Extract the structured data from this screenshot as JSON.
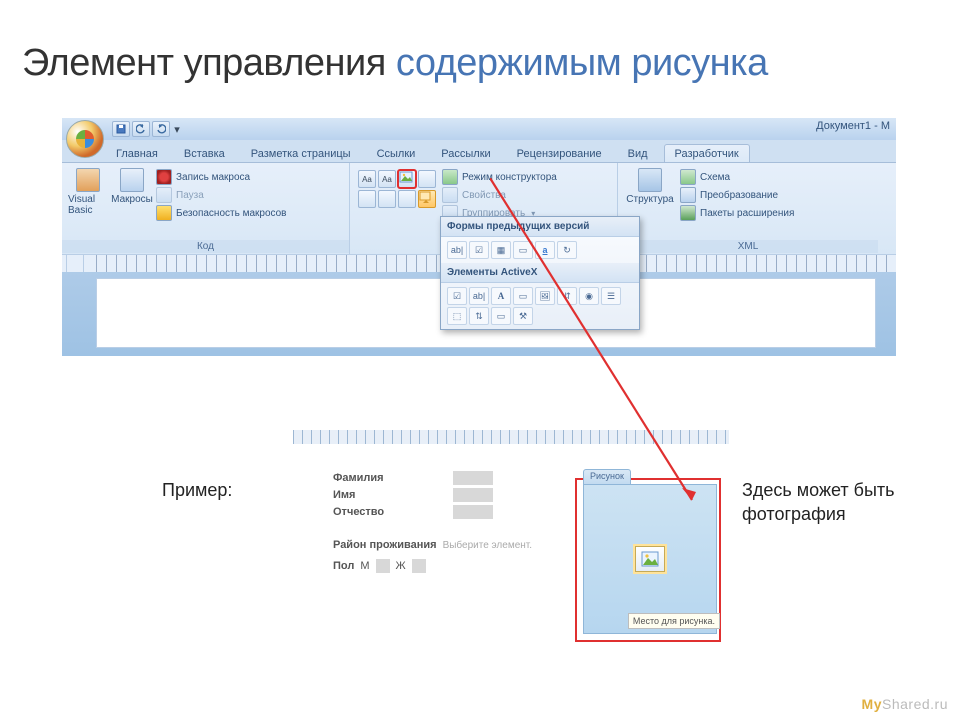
{
  "slide": {
    "title_a": "Элемент управления ",
    "title_b": "содержимым рисунка",
    "example_label": "Пример:",
    "photo_hint": "Здесь может быть фотография",
    "watermark_a": "My",
    "watermark_b": "Shared",
    "watermark_c": ".ru"
  },
  "word": {
    "doc_name": "Документ1 - M",
    "qat": [
      "save-icon",
      "undo-icon",
      "redo-icon",
      "dropdown-icon"
    ],
    "tabs": [
      "Главная",
      "Вставка",
      "Разметка страницы",
      "Ссылки",
      "Рассылки",
      "Рецензирование",
      "Вид",
      "Разработчик"
    ],
    "active_tab_index": 7,
    "groups": {
      "code": {
        "label": "Код",
        "visual_basic": "Visual Basic",
        "macros": "Макросы",
        "record_macro": "Запись макроса",
        "pause": "Пауза",
        "macro_security": "Безопасность макросов"
      },
      "controls": {
        "design_mode": "Режим конструктора",
        "properties": "Свойства",
        "group": "Группировать"
      },
      "xml": {
        "label": "XML",
        "structure": "Структура",
        "schema": "Схема",
        "transform": "Преобразование",
        "expansion": "Пакеты расширения"
      }
    },
    "legacy_panel": {
      "legacy_hdr": "Формы предыдущих версий",
      "activex_hdr": "Элементы ActiveX"
    }
  },
  "form": {
    "surname": "Фамилия",
    "name": "Имя",
    "patronymic": "Отчество",
    "region": "Район проживания",
    "region_hint": "Выберите элемент.",
    "sex_label": "Пол",
    "sex_m": "М",
    "sex_f": "Ж",
    "pic_tab": "Рисунок",
    "pic_tooltip": "Место для рисунка."
  }
}
